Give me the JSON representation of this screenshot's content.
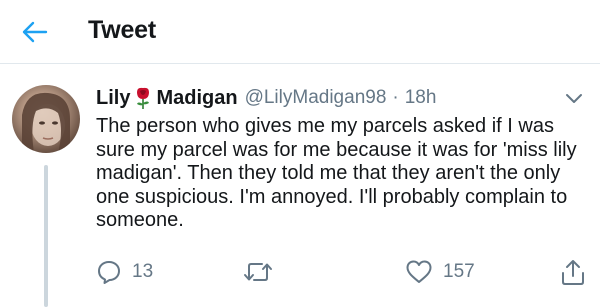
{
  "header": {
    "title": "Tweet"
  },
  "tweet": {
    "display_name_first": "Lily",
    "display_name_last": "Madigan",
    "handle": "@LilyMadigan98",
    "separator": "·",
    "time": "18h",
    "text": "The person who gives me my parcels asked if I was sure my parcel was for me because it was for 'miss lily madigan'. Then they told me that they aren't the only one suspicious. I'm annoyed. I'll probably complain to someone.",
    "name_emoji_icon": "rose-icon"
  },
  "actions": {
    "reply_count": "13",
    "like_count": "157"
  },
  "colors": {
    "accent": "#1da1f2",
    "secondary_text": "#657786",
    "divider": "#e1e8ed",
    "rose": "#c8102e"
  }
}
